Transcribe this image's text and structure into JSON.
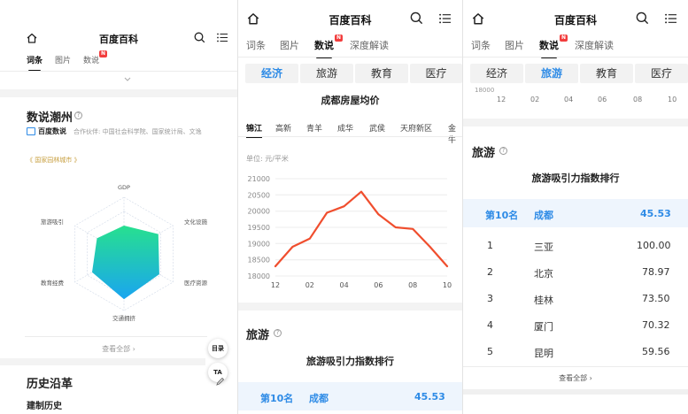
{
  "app": {
    "title": "百度百科"
  },
  "panel1": {
    "tabs": [
      {
        "label": "词条"
      },
      {
        "label": "图片"
      },
      {
        "label": "数说"
      }
    ],
    "section_title": "数说潮州",
    "source_brand": "百度数说",
    "partners": "合作伙伴: 中国社会科学院、国家统计局、文逸",
    "tag": "国家园林城市",
    "radar": {
      "axes": [
        "GDP",
        "文化设施",
        "医疗资源",
        "交通拥挤",
        "教育经费",
        "旅游吸引"
      ],
      "values": [
        0.5,
        0.7,
        0.72,
        0.8,
        0.65,
        0.55
      ]
    },
    "view_all": "查看全部",
    "history_title": "历史沿革",
    "history_sub": "建制历史",
    "float_toc": "目录",
    "float_ta": "TA"
  },
  "panel2": {
    "tabs": [
      {
        "label": "词条"
      },
      {
        "label": "图片"
      },
      {
        "label": "数说"
      },
      {
        "label": "深度解读"
      }
    ],
    "categories": [
      "经济",
      "旅游",
      "教育",
      "医疗"
    ],
    "active_category": "经济",
    "chart_title": "成都房屋均价",
    "districts": [
      "锦江",
      "高新",
      "青羊",
      "成华",
      "武侯",
      "天府新区",
      "金牛"
    ],
    "unit": "单位: 元/平米",
    "tourism_title": "旅游",
    "ranking_title": "旅游吸引力指数排行",
    "my_rank": {
      "rank": "第10名",
      "city": "成都",
      "score": "45.53"
    }
  },
  "panel3": {
    "tabs": [
      {
        "label": "词条"
      },
      {
        "label": "图片"
      },
      {
        "label": "数说"
      },
      {
        "label": "深度解读"
      }
    ],
    "categories": [
      "经济",
      "旅游",
      "教育",
      "医疗"
    ],
    "active_category": "旅游",
    "residual_y": "18000",
    "residual_x": [
      "12",
      "02",
      "04",
      "06",
      "08",
      "10"
    ],
    "tourism_title": "旅游",
    "ranking_title": "旅游吸引力指数排行",
    "my_rank": {
      "rank": "第10名",
      "city": "成都",
      "score": "45.53"
    },
    "ranking": [
      {
        "rank": "1",
        "city": "三亚",
        "score": "100.00"
      },
      {
        "rank": "2",
        "city": "北京",
        "score": "78.97"
      },
      {
        "rank": "3",
        "city": "桂林",
        "score": "73.50"
      },
      {
        "rank": "4",
        "city": "厦门",
        "score": "70.32"
      },
      {
        "rank": "5",
        "city": "昆明",
        "score": "59.56"
      }
    ],
    "view_all": "查看全部"
  },
  "chart_data": {
    "type": "line",
    "title": "成都房屋均价",
    "ylabel": "单位: 元/平米",
    "x": [
      "12",
      "01",
      "02",
      "03",
      "04",
      "05",
      "06",
      "07",
      "08",
      "09",
      "10"
    ],
    "x_ticks": [
      "12",
      "02",
      "04",
      "06",
      "08",
      "10"
    ],
    "values": [
      18300,
      18900,
      19150,
      19950,
      20150,
      20600,
      19900,
      19500,
      19450,
      18900,
      18300
    ],
    "ylim": [
      18000,
      21000
    ],
    "y_ticks": [
      "21000",
      "20500",
      "20000",
      "19500",
      "19000",
      "18500",
      "18000"
    ],
    "color": "#f04e2e",
    "grid": true
  }
}
